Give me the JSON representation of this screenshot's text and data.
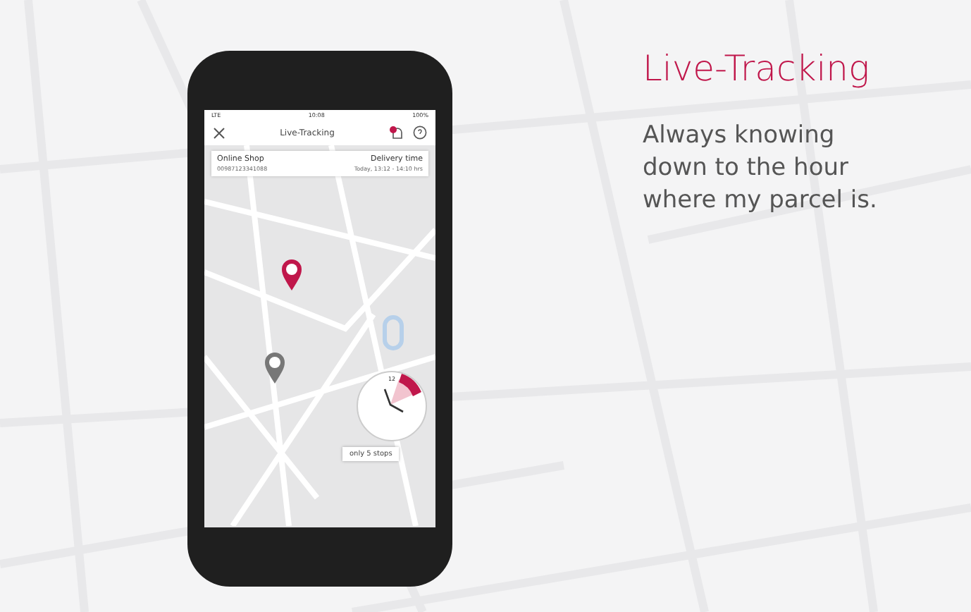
{
  "headline": "Live-Tracking",
  "tagline": "Always knowing down to the hour where my parcel is.",
  "phone": {
    "status_bar": {
      "carrier": "LTE",
      "time": "10:08",
      "battery": "100%"
    },
    "nav": {
      "title": "Live-Tracking",
      "notification": true
    },
    "delivery_card": {
      "shop": "Online Shop",
      "tracking_number": "00987123341088",
      "label": "Delivery time",
      "window": "Today, 13:12 - 14:10 hrs"
    },
    "clock": {
      "hour_mark": "12"
    },
    "stops": "only 5 stops"
  }
}
